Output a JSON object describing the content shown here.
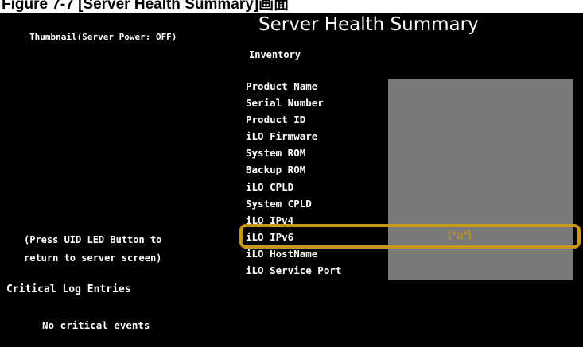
{
  "figure": {
    "title": "Figure 7-7 [Server Health Summary]画面"
  },
  "screen": {
    "title": "Server Health Summary",
    "thumbnail_label": "Thumbnail(Server Power: OFF)",
    "inventory_title": "Inventory",
    "inventory_items": [
      "Product Name",
      "Serial Number",
      "Product ID",
      "iLO Firmware",
      "System ROM",
      "Backup ROM",
      "iLO CPLD",
      "System CPLD",
      "iLO IPv4",
      "iLO IPv6",
      "iLO HostName",
      "iLO Service Port"
    ],
    "highlight_note": "(*a*)",
    "uid_line1": "(Press UID LED Button to",
    "uid_line2": "return to server screen)",
    "critical_title": "Critical Log Entries",
    "critical_message": "No critical events"
  },
  "colors": {
    "background": "#000000",
    "text": "#ffffff",
    "highlight": "#c8971c",
    "panel": "#7a7a7a"
  }
}
